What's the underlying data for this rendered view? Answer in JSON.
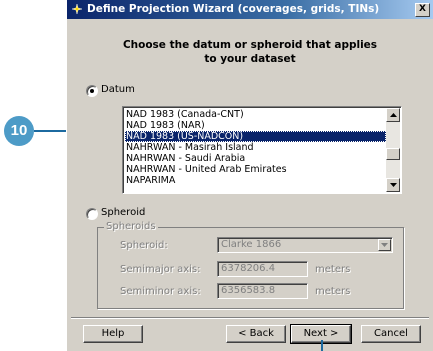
{
  "window": {
    "title": "Define Projection Wizard (coverages, grids, TINs)",
    "close_glyph": "X"
  },
  "heading": {
    "line1": "Choose the datum or spheroid that applies",
    "line2": "to your dataset"
  },
  "datum": {
    "label": "Datum",
    "selected": true,
    "items": [
      "NAD 1983 (Canada-CNT)",
      "NAD 1983 (NAR)",
      "NAD 1983 (US-NADCON)",
      "NAHRWAN - Masirah Island",
      "NAHRWAN - Saudi Arabia",
      "NAHRWAN - United Arab Emirates",
      "NAPARIMA"
    ],
    "selected_item": "NAD 1983 (US-NADCON)"
  },
  "spheroid": {
    "label": "Spheroid",
    "selected": false,
    "group_title": "Spheroids",
    "spheroid_label": "Spheroid:",
    "spheroid_value": "Clarke 1866",
    "semimajor_label": "Semimajor axis:",
    "semimajor_value": "6378206.4",
    "semimajor_unit": "meters",
    "semiminor_label": "Semiminor axis:",
    "semiminor_value": "6356583.8",
    "semiminor_unit": "meters"
  },
  "buttons": {
    "help": "Help",
    "back": "< Back",
    "next": "Next >",
    "cancel": "Cancel"
  },
  "callout": {
    "number": "10",
    "color": "#4d9bc7"
  },
  "colors": {
    "titlebar": "#0a246a",
    "face": "#d4d0c8",
    "selection": "#0a246a"
  }
}
